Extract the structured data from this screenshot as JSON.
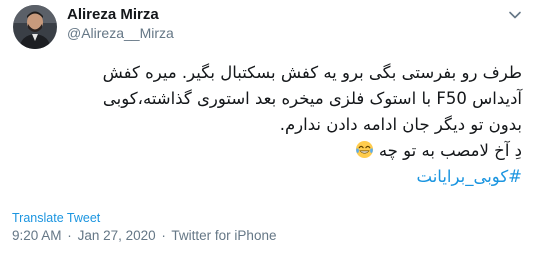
{
  "author": {
    "display_name": "Alireza Mirza",
    "handle": "@Alireza__Mirza"
  },
  "tweet": {
    "lines": [
      "طرف رو بفرستی بگی برو یه کفش بسکتبال بگیر. میره کفش",
      "آدیداس F50 با استوک فلزی میخره بعد استوری گذاشته،کوبی",
      "بدون تو دیگر جان ادامه دادن ندارم.",
      "دِ آخ لامصب به تو چه"
    ],
    "emoji": "face-with-tears-of-joy",
    "hashtag": "#کوبی_برایانت"
  },
  "translate_label": "Translate Tweet",
  "meta": {
    "time": "9:20 AM",
    "separator": "·",
    "date": "Jan 27, 2020",
    "source": "Twitter for iPhone"
  },
  "colors": {
    "link": "#1b95e0",
    "muted": "#657786",
    "text": "#14171a"
  }
}
